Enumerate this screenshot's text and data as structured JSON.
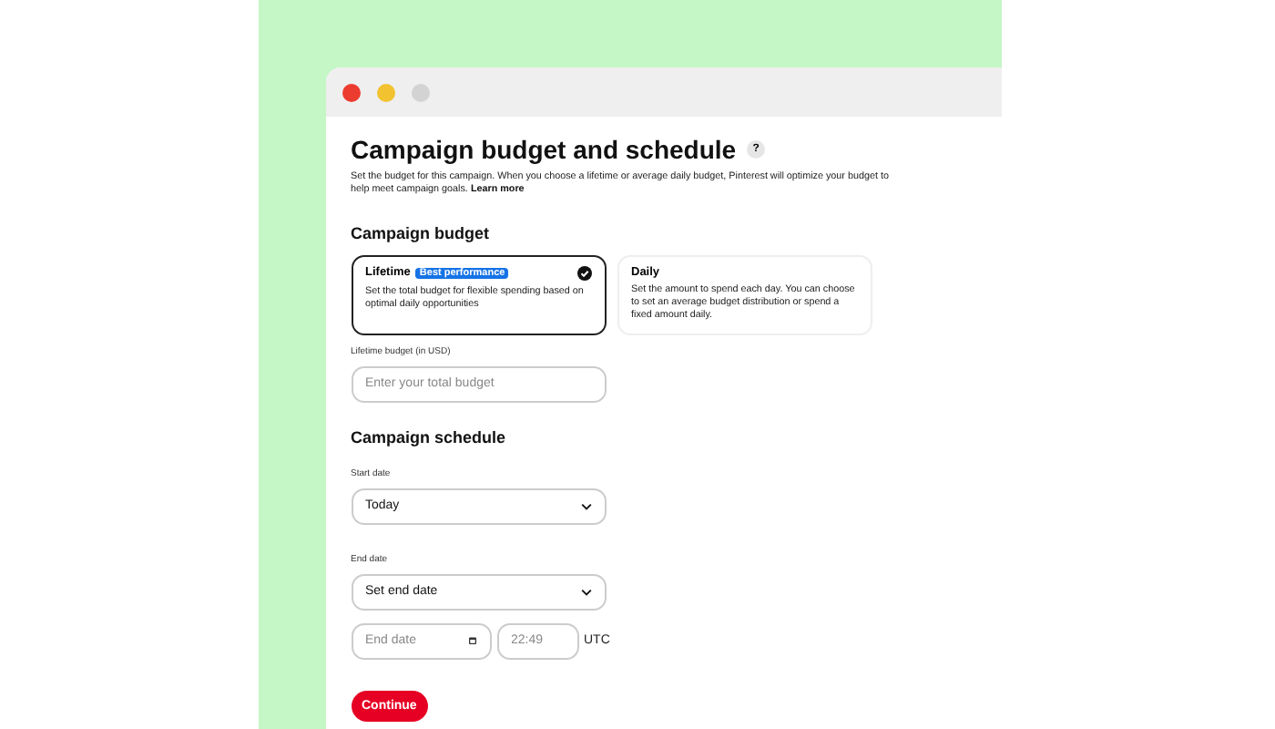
{
  "page": {
    "title": "Campaign budget and schedule",
    "help_icon": "?",
    "description": "Set the budget for this campaign. When you choose a lifetime or average daily budget, Pinterest will optimize your budget to help meet campaign goals.",
    "learn_more": "Learn more"
  },
  "budget": {
    "heading": "Campaign budget",
    "options": [
      {
        "title": "Lifetime",
        "badge": "Best performance",
        "text": "Set the total budget for flexible spending based on optimal daily opportunities",
        "selected": true
      },
      {
        "title": "Daily",
        "text": "Set the amount to spend each day. You can choose to set an average budget distribution or spend a fixed amount daily.",
        "selected": false
      }
    ],
    "field_label": "Lifetime budget (in USD)",
    "field_placeholder": "Enter your total budget"
  },
  "schedule": {
    "heading": "Campaign schedule",
    "start_label": "Start date",
    "start_value": "Today",
    "end_label": "End date",
    "end_value": "Set end date",
    "end_date_placeholder": "End date",
    "time_placeholder": "22:49",
    "timezone": "UTC"
  },
  "continue_button": "Continue"
}
